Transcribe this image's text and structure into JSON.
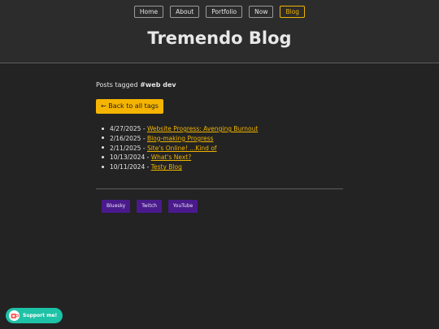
{
  "nav": {
    "items": [
      {
        "label": "Home"
      },
      {
        "label": "About"
      },
      {
        "label": "Portfolio"
      },
      {
        "label": "Now"
      },
      {
        "label": "Blog"
      }
    ],
    "active": "Blog"
  },
  "site": {
    "title": "Tremendo Blog"
  },
  "tag_page": {
    "prefix": "Posts tagged ",
    "tag": "#web dev",
    "back_label": "← Back to all tags"
  },
  "posts": [
    {
      "date": "4/27/2025 - ",
      "title": "Website Progress: Avenging Burnout"
    },
    {
      "date": "2/16/2025 - ",
      "title": "Blog-making Progress"
    },
    {
      "date": "2/11/2025 - ",
      "title": "Site's Online! ...Kind of"
    },
    {
      "date": "10/13/2024 - ",
      "title": "What's Next?"
    },
    {
      "date": "10/11/2024 - ",
      "title": "Testy Blog"
    }
  ],
  "socials": [
    {
      "label": "Bluesky"
    },
    {
      "label": "Twitch"
    },
    {
      "label": "YouTube"
    }
  ],
  "support": {
    "label": "Support me!",
    "icon": "ko-fi-cup-icon"
  },
  "colors": {
    "background": "#232323",
    "header": "#2c2c2c",
    "accent": "#f0b400",
    "social": "#4a1a8c",
    "support": "#1ec2a6"
  }
}
